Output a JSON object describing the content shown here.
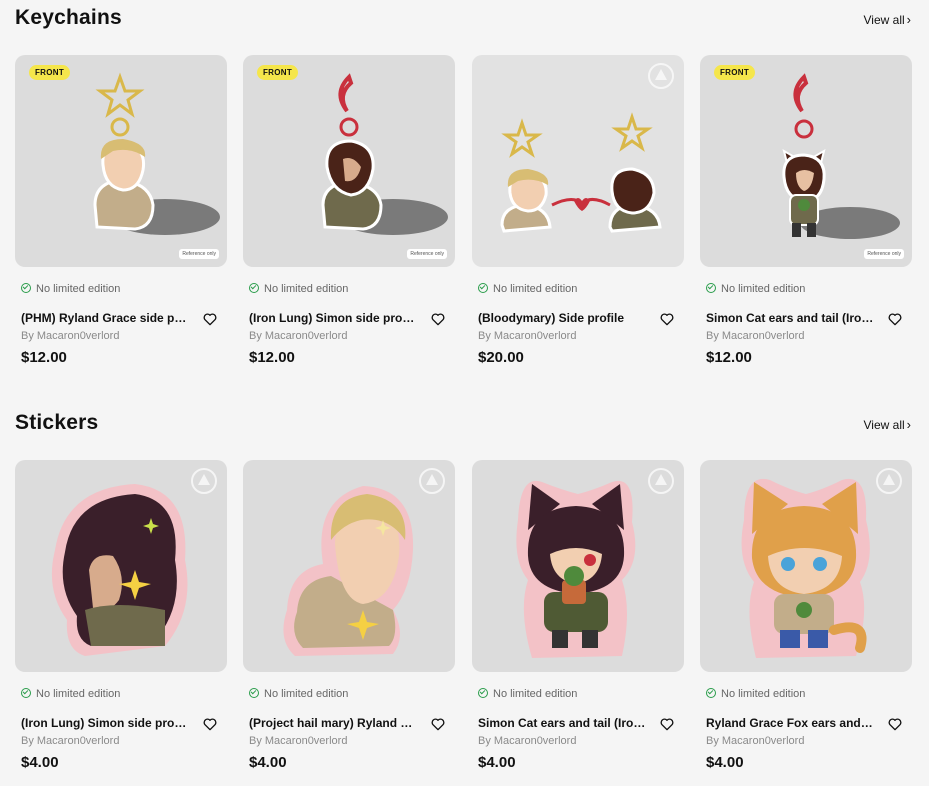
{
  "sections": [
    {
      "title": "Keychains",
      "view_all": "View all",
      "products": [
        {
          "badge": "FRONT",
          "ref": "Reference only",
          "limited": "No limited edition",
          "name": "(PHM) Ryland Grace side profile",
          "seller": "By Macaron0verlord",
          "price": "$12.00"
        },
        {
          "badge": "FRONT",
          "ref": "Reference only",
          "limited": "No limited edition",
          "name": "(Iron Lung) Simon side profile",
          "seller": "By Macaron0verlord",
          "price": "$12.00"
        },
        {
          "badge": "",
          "ref": "",
          "limited": "No limited edition",
          "name": "(Bloodymary) Side profile",
          "seller": "By Macaron0verlord",
          "price": "$20.00"
        },
        {
          "badge": "FRONT",
          "ref": "Reference only",
          "limited": "No limited edition",
          "name": "Simon Cat ears and tail (Iron Lung)",
          "seller": "By Macaron0verlord",
          "price": "$12.00"
        }
      ]
    },
    {
      "title": "Stickers",
      "view_all": "View all",
      "products": [
        {
          "badge": "",
          "ref": "",
          "limited": "No limited edition",
          "name": "(Iron Lung) Simon side profile",
          "seller": "By Macaron0verlord",
          "price": "$4.00"
        },
        {
          "badge": "",
          "ref": "",
          "limited": "No limited edition",
          "name": "(Project hail mary) Ryland Grace",
          "seller": "By Macaron0verlord",
          "price": "$4.00"
        },
        {
          "badge": "",
          "ref": "",
          "limited": "No limited edition",
          "name": "Simon Cat ears and tail (Iron Lung)",
          "seller": "By Macaron0verlord",
          "price": "$4.00"
        },
        {
          "badge": "",
          "ref": "",
          "limited": "No limited edition",
          "name": "Ryland Grace Fox ears and tail",
          "seller": "By Macaron0verlord",
          "price": "$4.00"
        }
      ]
    }
  ]
}
